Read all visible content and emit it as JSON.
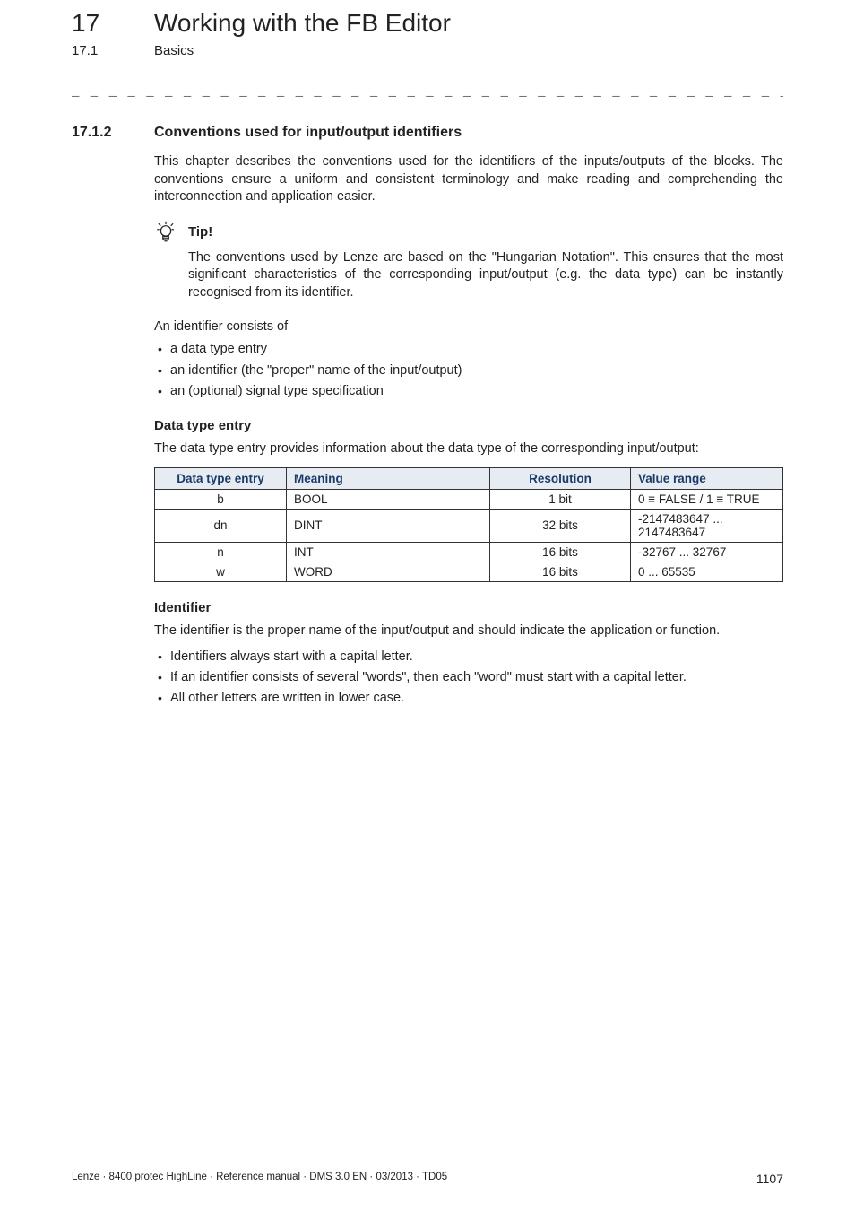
{
  "header": {
    "chapter_number": "17",
    "chapter_title": "Working with the FB Editor",
    "sub_number": "17.1",
    "sub_title": "Basics"
  },
  "separator": "_ _ _ _ _ _ _ _ _ _ _ _ _ _ _ _ _ _ _ _ _ _ _ _ _ _ _ _ _ _ _ _ _ _ _ _ _ _ _ _ _ _ _ _ _ _ _ _ _ _ _ _ _ _ _ _ _ _ _ _ _ _ _ _",
  "section": {
    "number": "17.1.2",
    "title": "Conventions used for input/output identifiers"
  },
  "intro_para": "This chapter describes the conventions used for the identifiers of the inputs/outputs of the blocks. The conventions ensure a uniform and consistent terminology and make reading and comprehending the interconnection and application easier.",
  "tip": {
    "label": "Tip!",
    "text": "The conventions used by Lenze are based on the \"Hungarian Notation\". This ensures that the most significant characteristics of the corresponding input/output (e.g. the data type) can be instantly recognised from its identifier."
  },
  "identifier_consists": {
    "lead": "An identifier consists of",
    "items": [
      "a data type entry",
      "an identifier (the \"proper\" name of the input/output)",
      "an (optional) signal type specification"
    ]
  },
  "data_type_entry": {
    "heading": "Data type entry",
    "para": "The data type entry provides information about the data type of the corresponding input/output:",
    "table": {
      "headers": [
        "Data type entry",
        "Meaning",
        "Resolution",
        "Value range"
      ],
      "rows": [
        {
          "entry": "b",
          "meaning": "BOOL",
          "resolution": "1 bit",
          "range": "0 ≡ FALSE / 1 ≡ TRUE"
        },
        {
          "entry": "dn",
          "meaning": "DINT",
          "resolution": "32 bits",
          "range": "-2147483647 ... 2147483647"
        },
        {
          "entry": "n",
          "meaning": "INT",
          "resolution": "16 bits",
          "range": "-32767 ... 32767"
        },
        {
          "entry": "w",
          "meaning": "WORD",
          "resolution": "16 bits",
          "range": "0 ... 65535"
        }
      ]
    }
  },
  "identifier_section": {
    "heading": "Identifier",
    "para": "The identifier is the proper name of the input/output and should indicate the application or function.",
    "items": [
      "Identifiers always start with a capital letter.",
      "If an identifier consists of several \"words\", then each \"word\" must start with a capital letter.",
      "All other letters are written in lower case."
    ]
  },
  "footer": {
    "left": "Lenze · 8400 protec HighLine · Reference manual · DMS 3.0 EN · 03/2013 · TD05",
    "page": "1107"
  }
}
